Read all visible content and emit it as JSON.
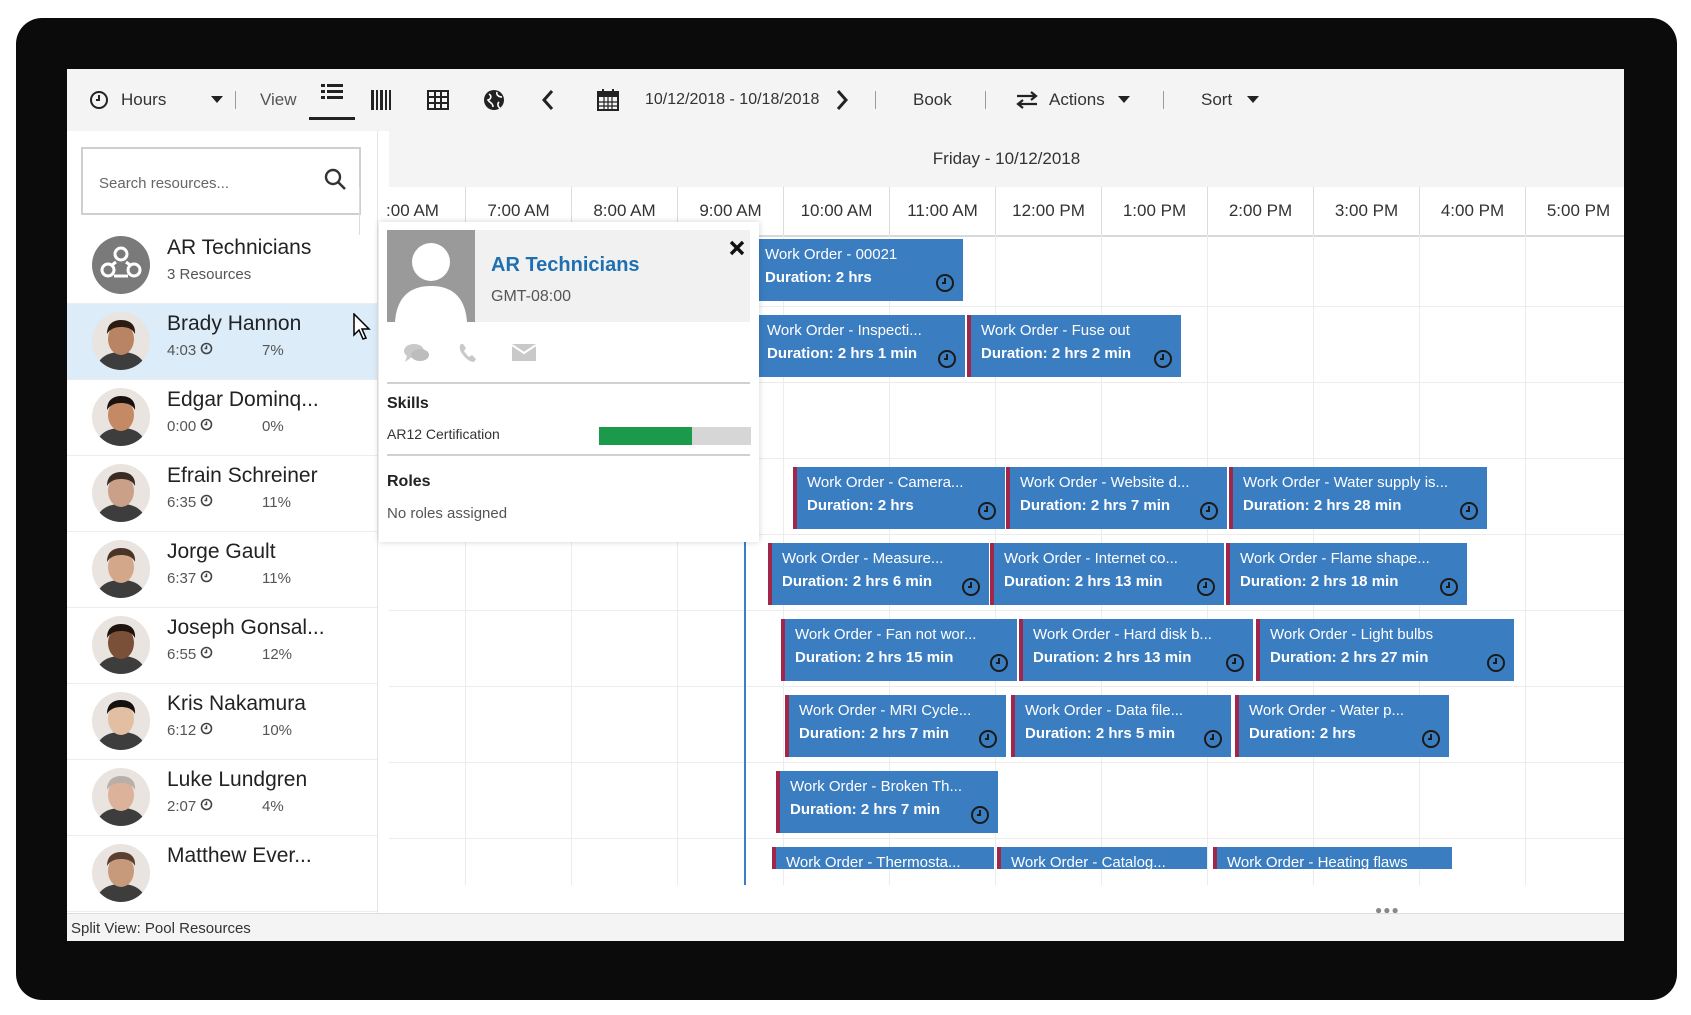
{
  "toolbar": {
    "hours_label": "Hours",
    "view_label": "View",
    "date_range": "10/12/2018 - 10/18/2018",
    "book_label": "Book",
    "actions_label": "Actions",
    "sort_label": "Sort"
  },
  "search": {
    "placeholder": "Search resources..."
  },
  "resources": [
    {
      "name": "AR Technicians",
      "sub": "3 Resources",
      "pct": "",
      "type": "group"
    },
    {
      "name": "Brady Hannon",
      "sub": "4:03",
      "pct": "7%",
      "selected": true,
      "skin": "#b98463",
      "hair": "#2b1b12"
    },
    {
      "name": "Edgar Dominq...",
      "sub": "0:00",
      "pct": "0%",
      "skin": "#c48a66",
      "hair": "#1a1210"
    },
    {
      "name": "Efrain Schreiner",
      "sub": "6:35",
      "pct": "11%",
      "skin": "#caa088",
      "hair": "#3a2c24"
    },
    {
      "name": "Jorge Gault",
      "sub": "6:37",
      "pct": "11%",
      "skin": "#d2a78a",
      "hair": "#4a3426"
    },
    {
      "name": "Joseph Gonsal...",
      "sub": "6:55",
      "pct": "12%",
      "skin": "#7a5038",
      "hair": "#1d1410"
    },
    {
      "name": "Kris Nakamura",
      "sub": "6:12",
      "pct": "10%",
      "skin": "#e2bfa2",
      "hair": "#151010"
    },
    {
      "name": "Luke Lundgren",
      "sub": "2:07",
      "pct": "4%",
      "skin": "#dcb39a",
      "hair": "#b8b0a8"
    },
    {
      "name": "Matthew Ever...",
      "sub": "",
      "pct": "",
      "skin": "#c79a7c",
      "hair": "#5a4030"
    }
  ],
  "day_header": "Friday - 10/12/2018",
  "hours": [
    ":00 AM",
    "7:00 AM",
    "8:00 AM",
    "9:00 AM",
    "10:00 AM",
    "11:00 AM",
    "12:00 PM",
    "1:00 PM",
    "2:00 PM",
    "3:00 PM",
    "4:00 PM",
    "5:00 PM"
  ],
  "work_orders": [
    [
      {
        "title": "Work Order - 00021",
        "duration": "Duration: 2 hrs"
      }
    ],
    [
      {
        "title": "Work Order - Inspecti...",
        "duration": "Duration: 2 hrs 1 min"
      },
      {
        "title": "Work Order - Fuse out",
        "duration": "Duration: 2 hrs 2 min"
      }
    ],
    [],
    [
      {
        "title": "Work Order - Camera...",
        "duration": "Duration: 2 hrs"
      },
      {
        "title": "Work Order - Website d...",
        "duration": "Duration: 2 hrs 7 min"
      },
      {
        "title": "Work Order - Water supply is...",
        "duration": "Duration: 2 hrs 28 min"
      }
    ],
    [
      {
        "title": "Work Order - Measure...",
        "duration": "Duration: 2 hrs 6 min"
      },
      {
        "title": "Work Order - Internet co...",
        "duration": "Duration: 2 hrs 13 min"
      },
      {
        "title": "Work Order - Flame shape...",
        "duration": "Duration: 2 hrs 18 min"
      }
    ],
    [
      {
        "title": "Work Order - Fan not wor...",
        "duration": "Duration: 2 hrs 15 min"
      },
      {
        "title": "Work Order - Hard disk b...",
        "duration": "Duration: 2 hrs 13 min"
      },
      {
        "title": "Work Order - Light bulbs",
        "duration": "Duration: 2 hrs 27 min"
      }
    ],
    [
      {
        "title": "Work Order - MRI Cycle...",
        "duration": "Duration: 2 hrs 7 min"
      },
      {
        "title": "Work Order - Data file...",
        "duration": "Duration: 2 hrs 5 min"
      },
      {
        "title": "Work Order - Water p...",
        "duration": "Duration: 2 hrs"
      }
    ],
    [
      {
        "title": "Work Order - Broken Th...",
        "duration": "Duration: 2 hrs 7 min"
      }
    ],
    [
      {
        "title": "Work Order - Thermosta...",
        "duration": ""
      },
      {
        "title": "Work Order - Catalog...",
        "duration": ""
      },
      {
        "title": "Work Order - Heating flaws",
        "duration": ""
      }
    ]
  ],
  "popup": {
    "name": "AR Technicians",
    "timezone": "GMT-08:00",
    "skills_heading": "Skills",
    "skill_name": "AR12 Certification",
    "skill_level": 0.61,
    "roles_heading": "Roles",
    "roles_text": "No roles assigned"
  },
  "status": "Split View: Pool Resources",
  "colors": {
    "booking_fill": "#3b7dc1",
    "booking_status_bar": "#a0264a",
    "accent": "#1f6fb3",
    "skill_fill": "#1a9a4a",
    "selected_row": "#dcecf9"
  }
}
